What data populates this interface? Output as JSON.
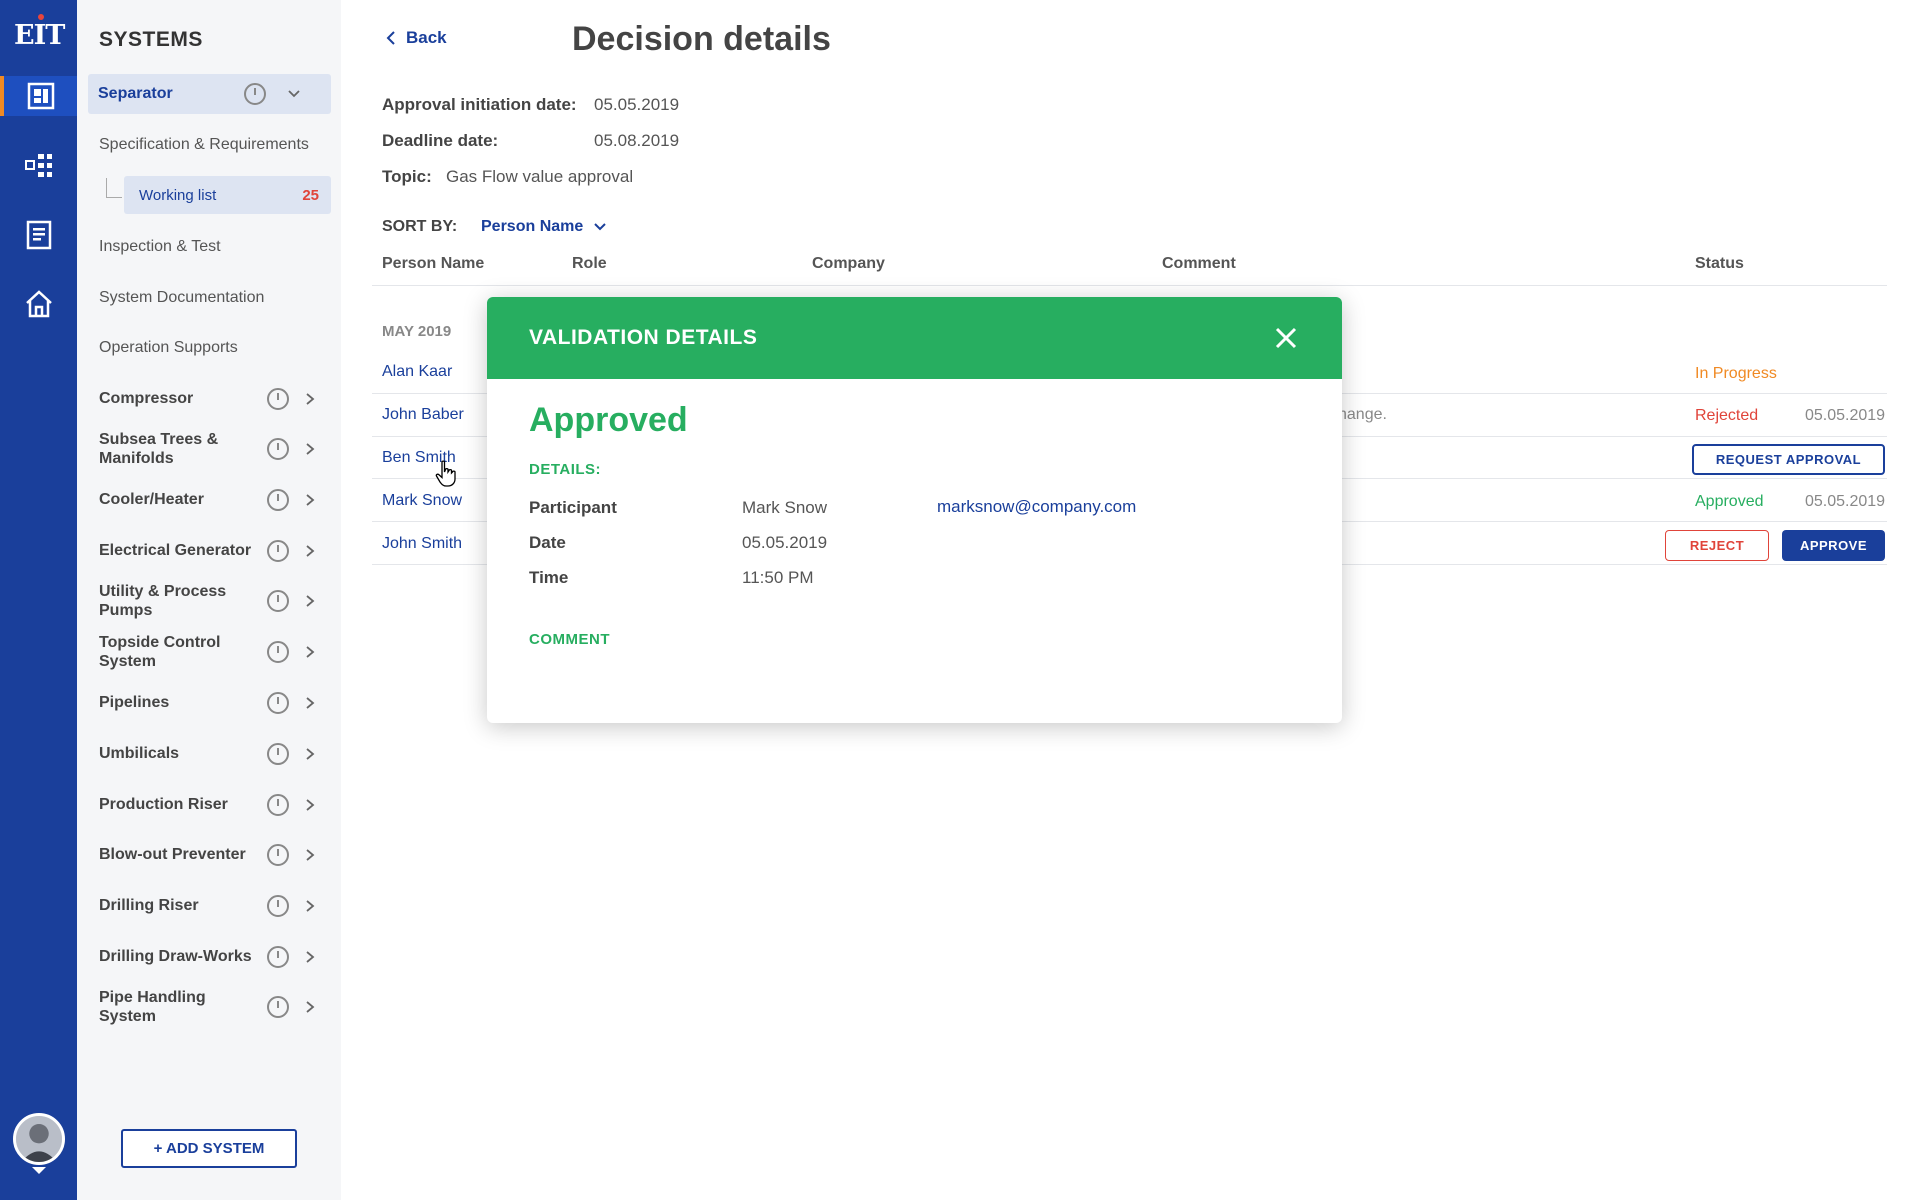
{
  "app": {
    "logo_text": "EIT"
  },
  "colors": {
    "primary": "#1a3f9b",
    "success": "#27ae60",
    "danger": "#e0443a",
    "warning": "#f08a24",
    "rail_accent": "#f08a24"
  },
  "rail": {
    "items": [
      "dashboard-icon",
      "diagram-icon",
      "document-icon",
      "home-icon"
    ]
  },
  "sidebar": {
    "title": "SYSTEMS",
    "selected": "Separator",
    "sub_items": [
      "Specification & Requirements",
      "Inspection & Test",
      "System Documentation",
      "Operation Supports"
    ],
    "working_list": {
      "label": "Working list",
      "count": "25"
    },
    "systems": [
      {
        "label": "Compressor"
      },
      {
        "label": "Subsea Trees & Manifolds"
      },
      {
        "label": "Cooler/Heater"
      },
      {
        "label": "Electrical Generator"
      },
      {
        "label": "Utility & Process Pumps"
      },
      {
        "label": "Topside Control System"
      },
      {
        "label": "Pipelines"
      },
      {
        "label": "Umbilicals"
      },
      {
        "label": "Production Riser"
      },
      {
        "label": "Blow-out Preventer"
      },
      {
        "label": "Drilling Riser"
      },
      {
        "label": "Drilling Draw-Works"
      },
      {
        "label": "Pipe Handling System"
      }
    ],
    "add_button": "+ ADD SYSTEM"
  },
  "main": {
    "back": "Back",
    "title": "Decision details",
    "meta": {
      "approval_label": "Approval initiation date:",
      "approval_value": "05.05.2019",
      "deadline_label": "Deadline date:",
      "deadline_value": "05.08.2019",
      "topic_label": "Topic:",
      "topic_value": "Gas Flow value approval"
    },
    "sort_label": "SORT BY:",
    "sort_value": "Person Name",
    "columns": [
      "Person Name",
      "Role",
      "Company",
      "Comment",
      "Status"
    ],
    "month": "MAY 2019",
    "rows": [
      {
        "name": "Alan Kaar",
        "status": "In Progress",
        "date": ""
      },
      {
        "name": "John Baber",
        "status": "Rejected",
        "date": "05.05.2019",
        "comment": "hange."
      },
      {
        "name": "Ben Smith",
        "action": "REQUEST APPROVAL"
      },
      {
        "name": "Mark Snow",
        "status": "Approved",
        "date": "05.05.2019"
      },
      {
        "name": "John Smith",
        "reject": "REJECT",
        "approve": "APPROVE"
      }
    ]
  },
  "modal": {
    "title": "VALIDATION DETAILS",
    "status": "Approved",
    "details_label": "DETAILS:",
    "participant_label": "Participant",
    "participant_value": "Mark Snow",
    "participant_email": "marksnow@company.com",
    "date_label": "Date",
    "date_value": "05.05.2019",
    "time_label": "Time",
    "time_value": "11:50 PM",
    "comment_label": "COMMENT"
  }
}
